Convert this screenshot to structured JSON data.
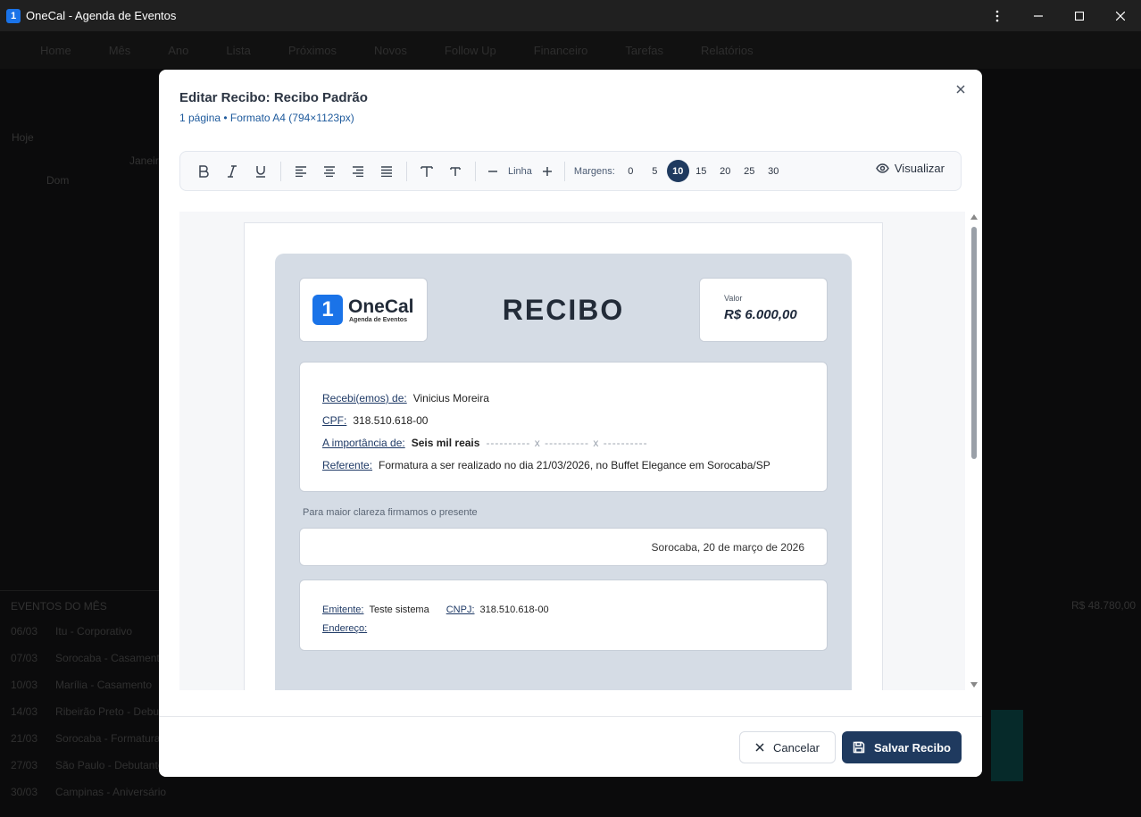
{
  "window": {
    "title": "OneCal - Agenda de Eventos",
    "logo_char": "1"
  },
  "background": {
    "nav_items": [
      "Home",
      "Mês",
      "Ano",
      "Lista",
      "Próximos",
      "Novos",
      "Follow Up",
      "Financeiro",
      "Tarefas",
      "Relatórios"
    ],
    "today": "Hoje",
    "month": "Janeiro",
    "weekday": "Dom",
    "events_header": "EVENTOS DO MÊS",
    "events_total": "R$ 48.780,00",
    "events": [
      {
        "date": "06/03",
        "text": "Itu - Corporativo"
      },
      {
        "date": "07/03",
        "text": "Sorocaba - Casamento"
      },
      {
        "date": "10/03",
        "text": "Marília - Casamento"
      },
      {
        "date": "14/03",
        "text": "Ribeirão Preto - Debutante"
      },
      {
        "date": "21/03",
        "text": "Sorocaba - Formatura"
      },
      {
        "date": "27/03",
        "text": "São Paulo - Debutante"
      },
      {
        "date": "30/03",
        "text": "Campinas - Aniversário"
      }
    ]
  },
  "modal": {
    "title": "Editar Recibo: Recibo Padrão",
    "subtitle": "1 página • Formato A4 (794×1123px)",
    "toolbar": {
      "line_label": "Linha",
      "margins_label": "Margens:",
      "margin_options": [
        "0",
        "5",
        "10",
        "15",
        "20",
        "25",
        "30"
      ],
      "active_margin": "10",
      "preview_label": "Visualizar"
    },
    "receipt": {
      "logo_name": "OneCal",
      "logo_tagline": "Agenda de Eventos",
      "title": "RECIBO",
      "value_label": "Valor",
      "value": "R$ 6.000,00",
      "received_from_label": "Recebi(emos) de:",
      "received_from": "Vinicius Moreira",
      "cpf_label": "CPF:",
      "cpf": "318.510.618-00",
      "amount_label": "A importância de:",
      "amount_words": "Seis mil reais",
      "amount_dashes": "---------- x ---------- x ----------",
      "reference_label": "Referente:",
      "reference": "Formatura a ser realizado no dia 21/03/2026, no Buffet Elegance em Sorocaba/SP",
      "clarity_text": "Para maior clareza firmamos o presente",
      "place_date": "Sorocaba, 20 de março de 2026",
      "issuer_label": "Emitente:",
      "issuer": "Teste sistema",
      "cnpj_label": "CNPJ:",
      "cnpj": "318.510.618-00",
      "address_label": "Endereço:",
      "address": ""
    },
    "footer": {
      "cancel_label": "Cancelar",
      "save_label": "Salvar Recibo"
    }
  },
  "colors": {
    "accent": "#1f3a5f",
    "brand_blue": "#1a73e8",
    "receipt_bg": "#d5dce5"
  }
}
